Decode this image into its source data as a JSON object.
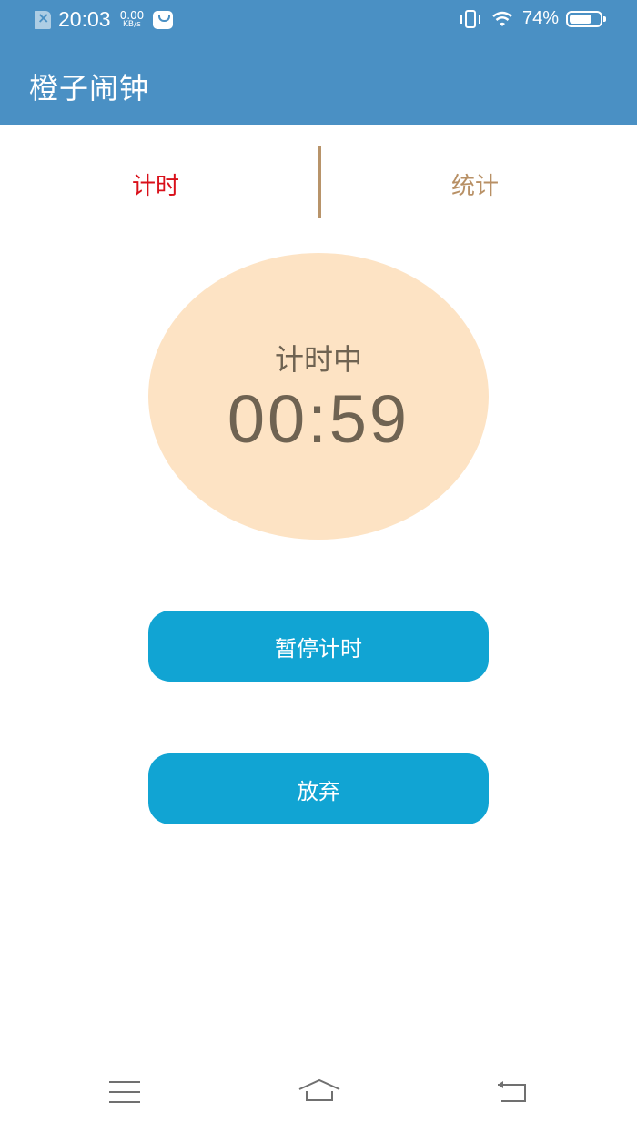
{
  "status_bar": {
    "time": "20:03",
    "net_speed_value": "0.00",
    "net_speed_unit": "KB/s",
    "battery_percent": "74%",
    "battery_level": 0.74,
    "icons": [
      "sim-error-icon",
      "message-icon",
      "vibrate-icon",
      "wifi-icon",
      "battery-icon"
    ]
  },
  "app_bar": {
    "title": "橙子闹钟"
  },
  "tabs": [
    {
      "label": "计时",
      "selected": true
    },
    {
      "label": "统计",
      "selected": false
    }
  ],
  "timer": {
    "status": "计时中",
    "time": "00:59"
  },
  "buttons": {
    "pause": "暂停计时",
    "give_up": "放弃"
  },
  "nav_bar": {
    "icons": [
      "menu-icon",
      "home-icon",
      "back-icon"
    ]
  },
  "colors": {
    "header": "#4a90c4",
    "tab_selected": "#d9101a",
    "tab_unselected": "#b89065",
    "clock_bg": "#fde3c4",
    "clock_text": "#6f6352",
    "button": "#11a4d3"
  }
}
